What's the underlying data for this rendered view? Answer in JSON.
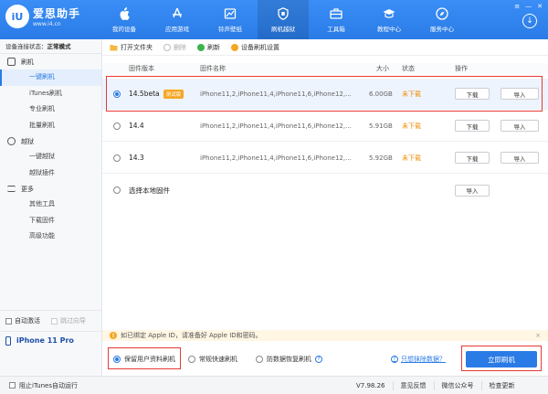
{
  "app": {
    "logo_mark": "iU",
    "name": "爱思助手",
    "url": "www.i4.cn"
  },
  "nav": [
    {
      "label": "我的设备",
      "icon": "apple-icon"
    },
    {
      "label": "应用游戏",
      "icon": "app-store-icon"
    },
    {
      "label": "铃声壁纸",
      "icon": "ringtone-icon"
    },
    {
      "label": "刷机越狱",
      "icon": "flash-icon",
      "active": true
    },
    {
      "label": "工具箱",
      "icon": "toolbox-icon"
    },
    {
      "label": "教程中心",
      "icon": "graduation-cap-icon"
    },
    {
      "label": "服务中心",
      "icon": "compass-icon"
    }
  ],
  "sidebar": {
    "connection_label": "设备连接状态：",
    "connection_value": "正常模式",
    "groups": [
      {
        "label": "刷机",
        "items": [
          "一键刷机",
          "iTunes刷机",
          "专业刷机",
          "批量刷机"
        ]
      },
      {
        "label": "越狱",
        "items": [
          "一键越狱",
          "越狱插件"
        ]
      },
      {
        "label": "更多",
        "items": [
          "其他工具",
          "下载固件",
          "高级功能"
        ]
      }
    ],
    "active_item": "一键刷机",
    "auto_activate": "自动激活",
    "skip_guide": "跳过向导",
    "device_name": "iPhone 11 Pro"
  },
  "toolbar": {
    "open_folder": "打开文件夹",
    "delete": "删除",
    "refresh": "刷新",
    "settings": "设备刷机设置"
  },
  "table": {
    "headers": {
      "version": "固件版本",
      "name": "固件名称",
      "size": "大小",
      "status": "状态",
      "action": "操作"
    },
    "rows": [
      {
        "version": "14.5beta",
        "tag": "测试版",
        "name": "iPhone11,2,iPhone11,4,iPhone11,6,iPhone12,...",
        "size": "6.00GB",
        "status": "未下载",
        "download": "下载",
        "import": "导入"
      },
      {
        "version": "14.4",
        "name": "iPhone11,2,iPhone11,4,iPhone11,6,iPhone12,...",
        "size": "5.91GB",
        "status": "未下载",
        "download": "下载",
        "import": "导入"
      },
      {
        "version": "14.3",
        "name": "iPhone11,2,iPhone11,4,iPhone11,6,iPhone12,...",
        "size": "5.92GB",
        "status": "未下载",
        "download": "下载",
        "import": "导入"
      }
    ],
    "local_label": "选择本地固件",
    "local_import": "导入"
  },
  "notice": {
    "text": "如已绑定 Apple ID，请准备好 Apple ID和密码。",
    "close": "×"
  },
  "options": {
    "keep_data": "保留用户资料刷机",
    "quick_flash": "常规快速刷机",
    "anti_recovery": "防数据恢复刷机",
    "lost_data_link": "只想抹除数据？",
    "flash_button": "立即刷机"
  },
  "statusbar": {
    "block_itunes": "阻止iTunes自动运行",
    "version": "V7.98.26",
    "feedback": "意见反馈",
    "wechat": "微信公众号",
    "update": "检查更新"
  },
  "colors": {
    "accent": "#2a7be6",
    "warning": "#f08c00",
    "highlight": "#e53935"
  }
}
